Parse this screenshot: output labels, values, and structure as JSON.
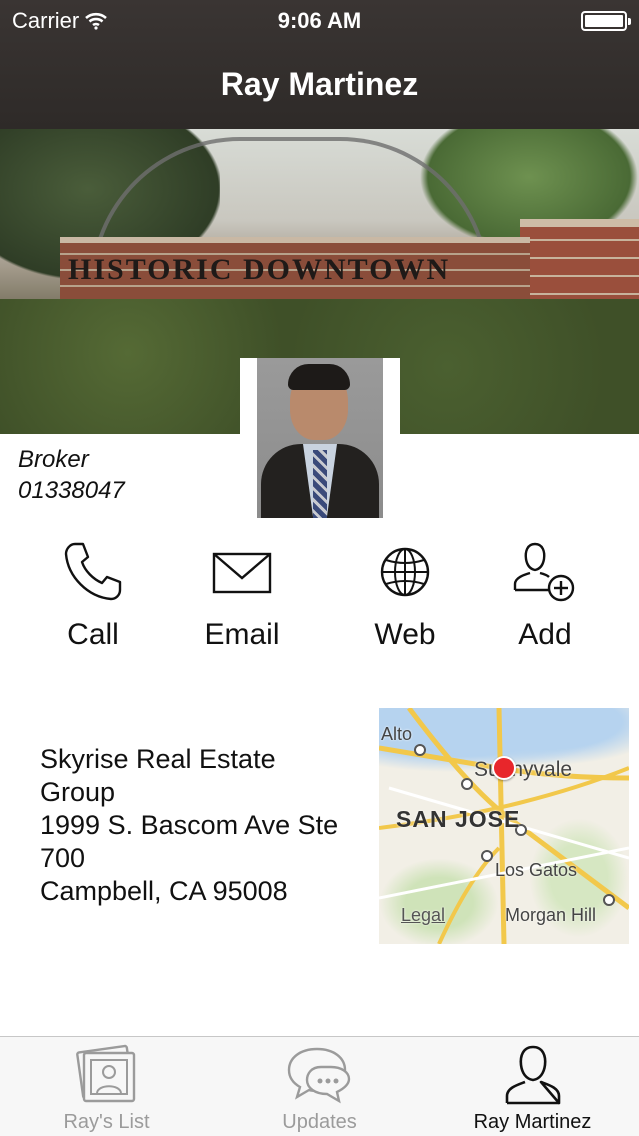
{
  "status_bar": {
    "carrier": "Carrier",
    "time": "9:06 AM"
  },
  "nav": {
    "title": "Ray Martinez"
  },
  "hero": {
    "sign_text": "HISTORIC DOWNTOWN"
  },
  "profile": {
    "role": "Broker",
    "license": "01338047"
  },
  "actions": [
    {
      "label": "Call",
      "icon": "phone-icon"
    },
    {
      "label": "Email",
      "icon": "envelope-icon"
    },
    {
      "label": "Web",
      "icon": "globe-icon"
    },
    {
      "label": "Add",
      "icon": "add-contact-icon"
    }
  ],
  "address": {
    "line1": "Skyrise Real Estate",
    "line2": "Group",
    "line3": "1999 S. Bascom Ave Ste",
    "line4": "700",
    "line5": "Campbell, CA 95008"
  },
  "map": {
    "label_alto": "Alto",
    "label_sunnyvale": "Sunnyvale",
    "label_san_jose": "SAN JOSE",
    "label_los_gatos": "Los Gatos",
    "label_morgan_hill": "Morgan Hill",
    "legal": "Legal"
  },
  "tabs": [
    {
      "label": "Ray's List",
      "icon": "photos-icon",
      "active": false
    },
    {
      "label": "Updates",
      "icon": "chat-bubbles-icon",
      "active": false
    },
    {
      "label": "Ray Martinez",
      "icon": "person-icon",
      "active": true
    }
  ],
  "colors": {
    "nav_bg": "#2e2a28",
    "pin": "#e8262b",
    "tab_inactive": "#9b9b9b",
    "tab_active": "#111111"
  }
}
